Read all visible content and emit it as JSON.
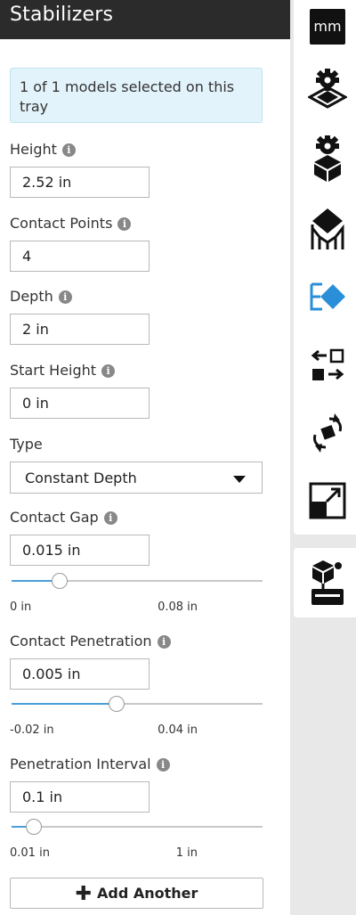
{
  "header": {
    "title": "Stabilizers"
  },
  "notice": {
    "text": "1 of 1 models selected on this tray"
  },
  "fields": {
    "height": {
      "label": "Height",
      "value": "2.52 in"
    },
    "contact_points": {
      "label": "Contact Points",
      "value": "4"
    },
    "depth": {
      "label": "Depth",
      "value": "2 in"
    },
    "start_height": {
      "label": "Start Height",
      "value": "0 in"
    },
    "type": {
      "label": "Type",
      "value": "Constant Depth"
    },
    "contact_gap": {
      "label": "Contact Gap",
      "value": "0.015 in",
      "min": "0 in",
      "max": "0.08 in",
      "level": 0.19
    },
    "contact_penetration": {
      "label": "Contact Penetration",
      "value": "0.005 in",
      "min": "-0.02 in",
      "max": "0.04 in",
      "level": 0.42
    },
    "penetration_interval": {
      "label": "Penetration Interval",
      "value": "0.1 in",
      "min": "0.01 in",
      "max": "1 in",
      "level": 0.09
    }
  },
  "add_button": {
    "label": "Add Another"
  },
  "toolbar": {
    "units_label": "mm",
    "tools": [
      "tray-gear-icon",
      "model-gear-icon",
      "supports-icon",
      "label-icon",
      "arrange-icon",
      "rotate-icon",
      "scale-icon",
      "stabilizers-icon"
    ]
  },
  "colors": {
    "header_bg": "#2b2b2b",
    "notice_bg": "#e3f3fb",
    "accent": "#4a9fd8",
    "toolbar_bg": "#e8e8e8"
  }
}
